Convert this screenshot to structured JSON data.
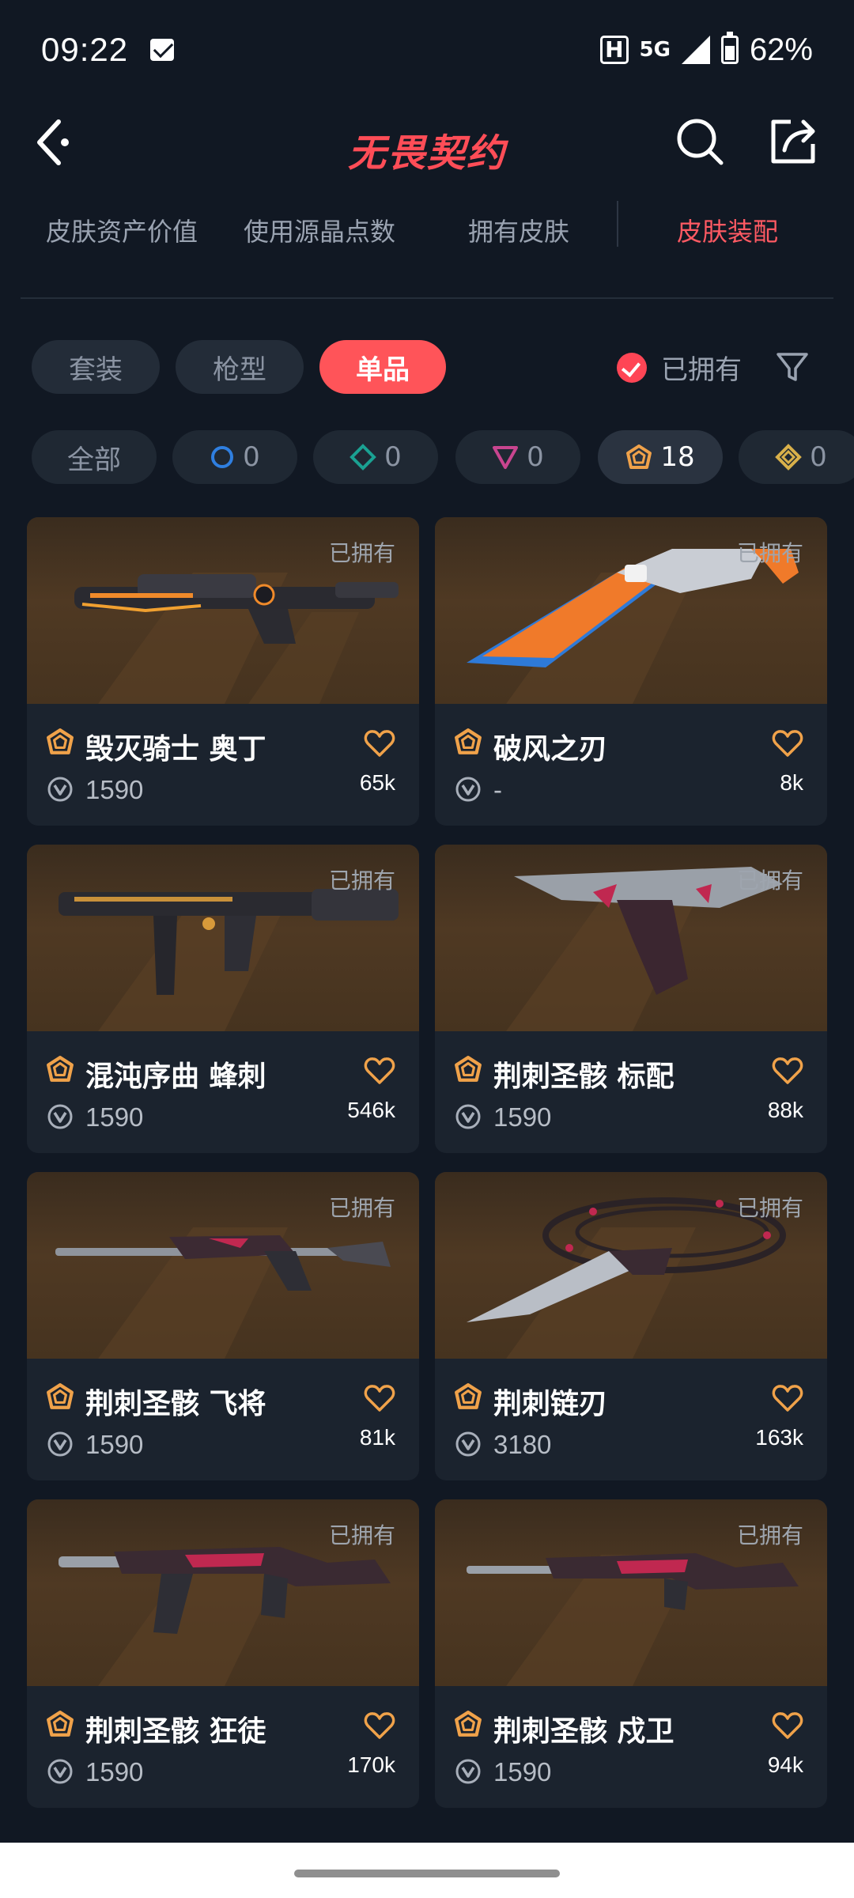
{
  "status_bar": {
    "time": "09:22",
    "network": "5G",
    "battery": "62%"
  },
  "header": {
    "title": "无畏契约",
    "icons": [
      "back-icon",
      "search-icon",
      "share-icon"
    ]
  },
  "tabs": [
    {
      "label": "皮肤资产价值"
    },
    {
      "label": "使用源晶点数"
    },
    {
      "label": "拥有皮肤"
    },
    {
      "label": "皮肤装配"
    }
  ],
  "type_filters": [
    {
      "label": "套装"
    },
    {
      "label": "枪型"
    },
    {
      "label": "单品"
    }
  ],
  "owned_filter_label": "已拥有",
  "tier_filters": [
    {
      "label": "全部"
    },
    {
      "count": "0",
      "icon": "select-tier-icon",
      "color": "#2f7fe0"
    },
    {
      "count": "0",
      "icon": "deluxe-tier-icon",
      "color": "#1aa192"
    },
    {
      "count": "0",
      "icon": "premium-tier-icon",
      "color": "#c8458f"
    },
    {
      "count": "18",
      "icon": "ultra-tier-icon",
      "color": "#f0a24a"
    },
    {
      "count": "0",
      "icon": "exclusive-tier-icon",
      "color": "#d8b04a"
    }
  ],
  "skins": [
    {
      "name": "毁灭骑士 奥丁",
      "price": "1590",
      "likes": "65k",
      "owned": "已拥有"
    },
    {
      "name": "破风之刃",
      "price": "-",
      "likes": "8k",
      "owned": "已拥有"
    },
    {
      "name": "混沌序曲 蜂刺",
      "price": "1590",
      "likes": "546k",
      "owned": "已拥有"
    },
    {
      "name": "荆刺圣骸 标配",
      "price": "1590",
      "likes": "88k",
      "owned": "已拥有"
    },
    {
      "name": "荆刺圣骸 飞将",
      "price": "1590",
      "likes": "81k",
      "owned": "已拥有"
    },
    {
      "name": "荆刺链刃",
      "price": "3180",
      "likes": "163k",
      "owned": "已拥有"
    },
    {
      "name": "荆刺圣骸 狂徒",
      "price": "1590",
      "likes": "170k",
      "owned": "已拥有"
    },
    {
      "name": "荆刺圣骸 戍卫",
      "price": "1590",
      "likes": "94k",
      "owned": "已拥有"
    }
  ],
  "colors": {
    "accent": "#ff5459",
    "title_red": "#ff4d57",
    "background": "#111823",
    "card": "#1b232e",
    "ultra_tier": "#f0a24a"
  }
}
